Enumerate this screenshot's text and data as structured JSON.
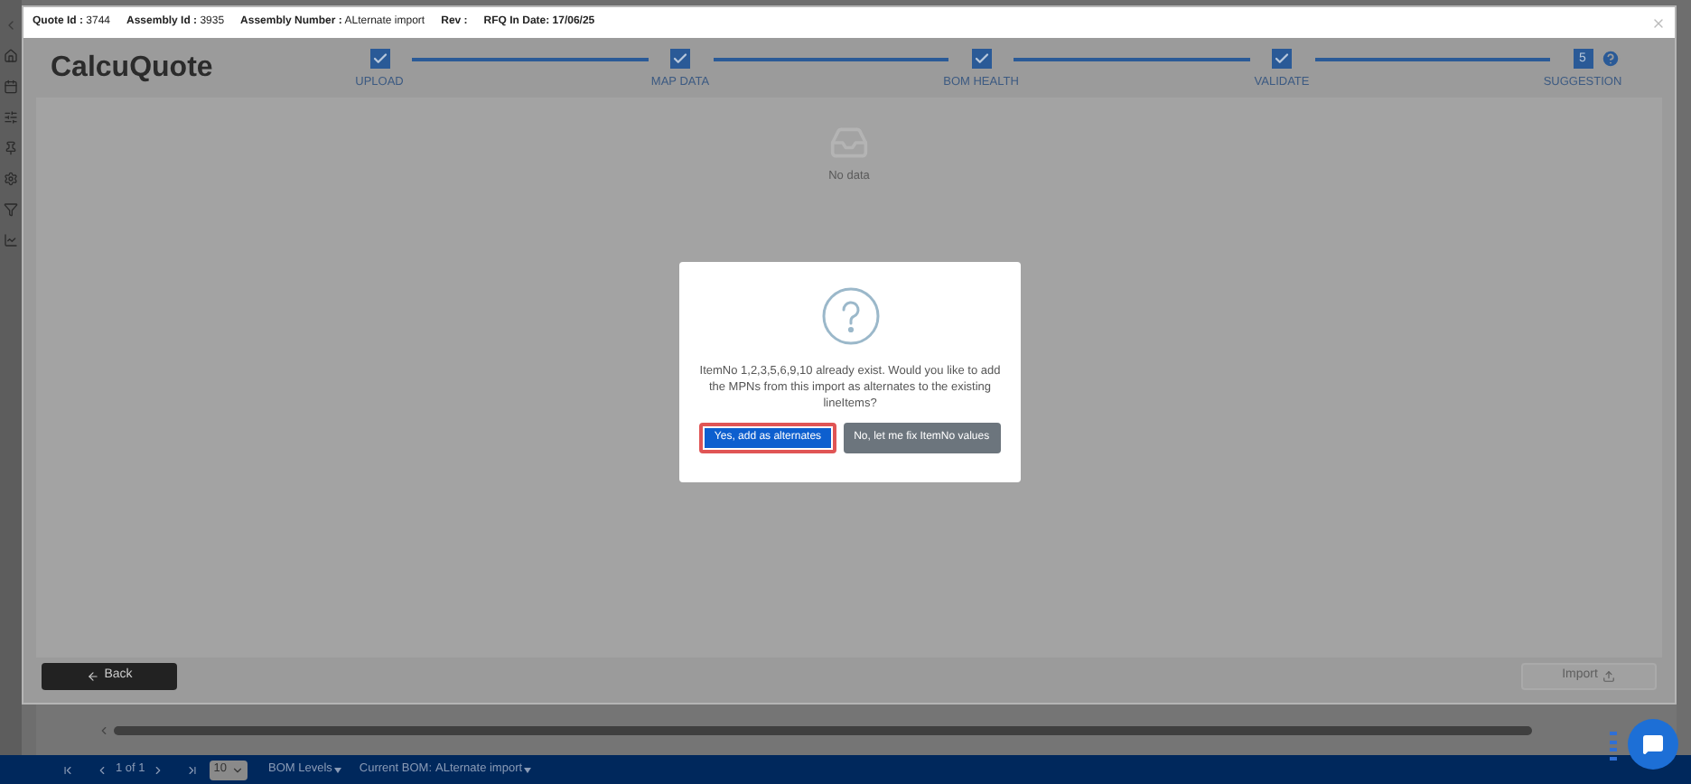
{
  "header": {
    "fields": [
      {
        "label": "Quote Id :",
        "value": "3744"
      },
      {
        "label": "Assembly Id :",
        "value": "3935"
      },
      {
        "label": "Assembly Number :",
        "value": "ALternate import"
      },
      {
        "label": "Rev :"
      },
      {
        "label": "RFQ In Date: 17/06/25"
      }
    ]
  },
  "logo": "CalcuQuote",
  "steps": [
    {
      "label": "UPLOAD",
      "done": true
    },
    {
      "label": "MAP DATA",
      "done": true
    },
    {
      "label": "BOM HEALTH",
      "done": true
    },
    {
      "label": "VALIDATE",
      "done": true
    },
    {
      "label": "SUGGESTION",
      "done": false,
      "number": "5"
    }
  ],
  "empty_state": "No data",
  "dialog": {
    "message": "ItemNo 1,2,3,5,6,9,10 already exist. Would you like to add the MPNs from this import as alternates to the existing lineItems?",
    "buttons": [
      {
        "label": "Yes, add as alternates",
        "kind": "primary",
        "focused": true
      },
      {
        "label": "No, let me fix ItemNo values",
        "kind": "secondary",
        "focused": false
      }
    ]
  },
  "back_button": "Back",
  "import_button": {
    "label": "Import",
    "disabled": true
  },
  "pager": {
    "position": "1 of 1",
    "page_size": "10",
    "bom_levels": "BOM Levels",
    "current_bom_label": "Current BOM:",
    "current_bom": "ALternate import"
  }
}
